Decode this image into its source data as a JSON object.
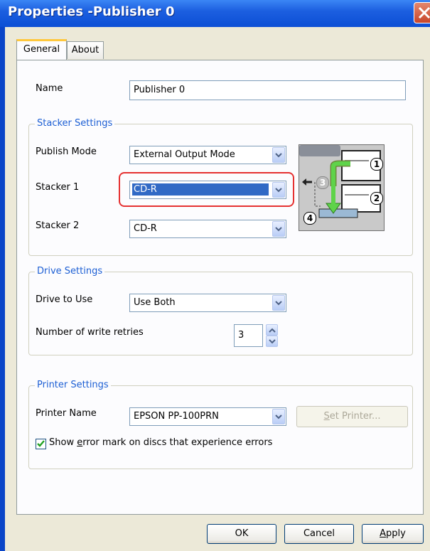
{
  "window": {
    "title": "Properties -Publisher 0"
  },
  "tabs": [
    {
      "label": "General"
    },
    {
      "label": "About"
    }
  ],
  "name_row": {
    "label": "Name",
    "value": "Publisher 0"
  },
  "stacker_settings": {
    "legend": "Stacker Settings",
    "publish_mode": {
      "label": "Publish Mode",
      "value": "External Output Mode"
    },
    "stacker1": {
      "label": "Stacker 1",
      "value": "CD-R"
    },
    "stacker2": {
      "label": "Stacker 2",
      "value": "CD-R"
    },
    "diagram_labels": [
      "1",
      "2",
      "3",
      "4"
    ]
  },
  "drive_settings": {
    "legend": "Drive Settings",
    "drive_to_use": {
      "label": "Drive to Use",
      "value": "Use Both"
    },
    "write_retries": {
      "label": "Number of write retries",
      "value": "3"
    }
  },
  "printer_settings": {
    "legend": "Printer Settings",
    "printer_name": {
      "label": "Printer Name",
      "value": "EPSON PP-100PRN"
    },
    "set_printer": {
      "pre": "",
      "underlined": "S",
      "post": "et Printer..."
    },
    "error_mark": {
      "pre": "Show ",
      "underlined": "e",
      "post": "rror mark on discs that experience errors",
      "checked": true
    }
  },
  "buttons": {
    "ok": "OK",
    "cancel": "Cancel",
    "apply": {
      "underlined": "A",
      "post": "pply"
    }
  },
  "colors": {
    "title_bar": "#0c4fd5",
    "legend_text": "#1d5fd4",
    "highlight": "#e53131",
    "selection": "#316ac5"
  },
  "icons": [
    "close-icon",
    "dropdown-arrow-icon",
    "spin-up-icon",
    "spin-down-icon",
    "checkmark-icon"
  ]
}
